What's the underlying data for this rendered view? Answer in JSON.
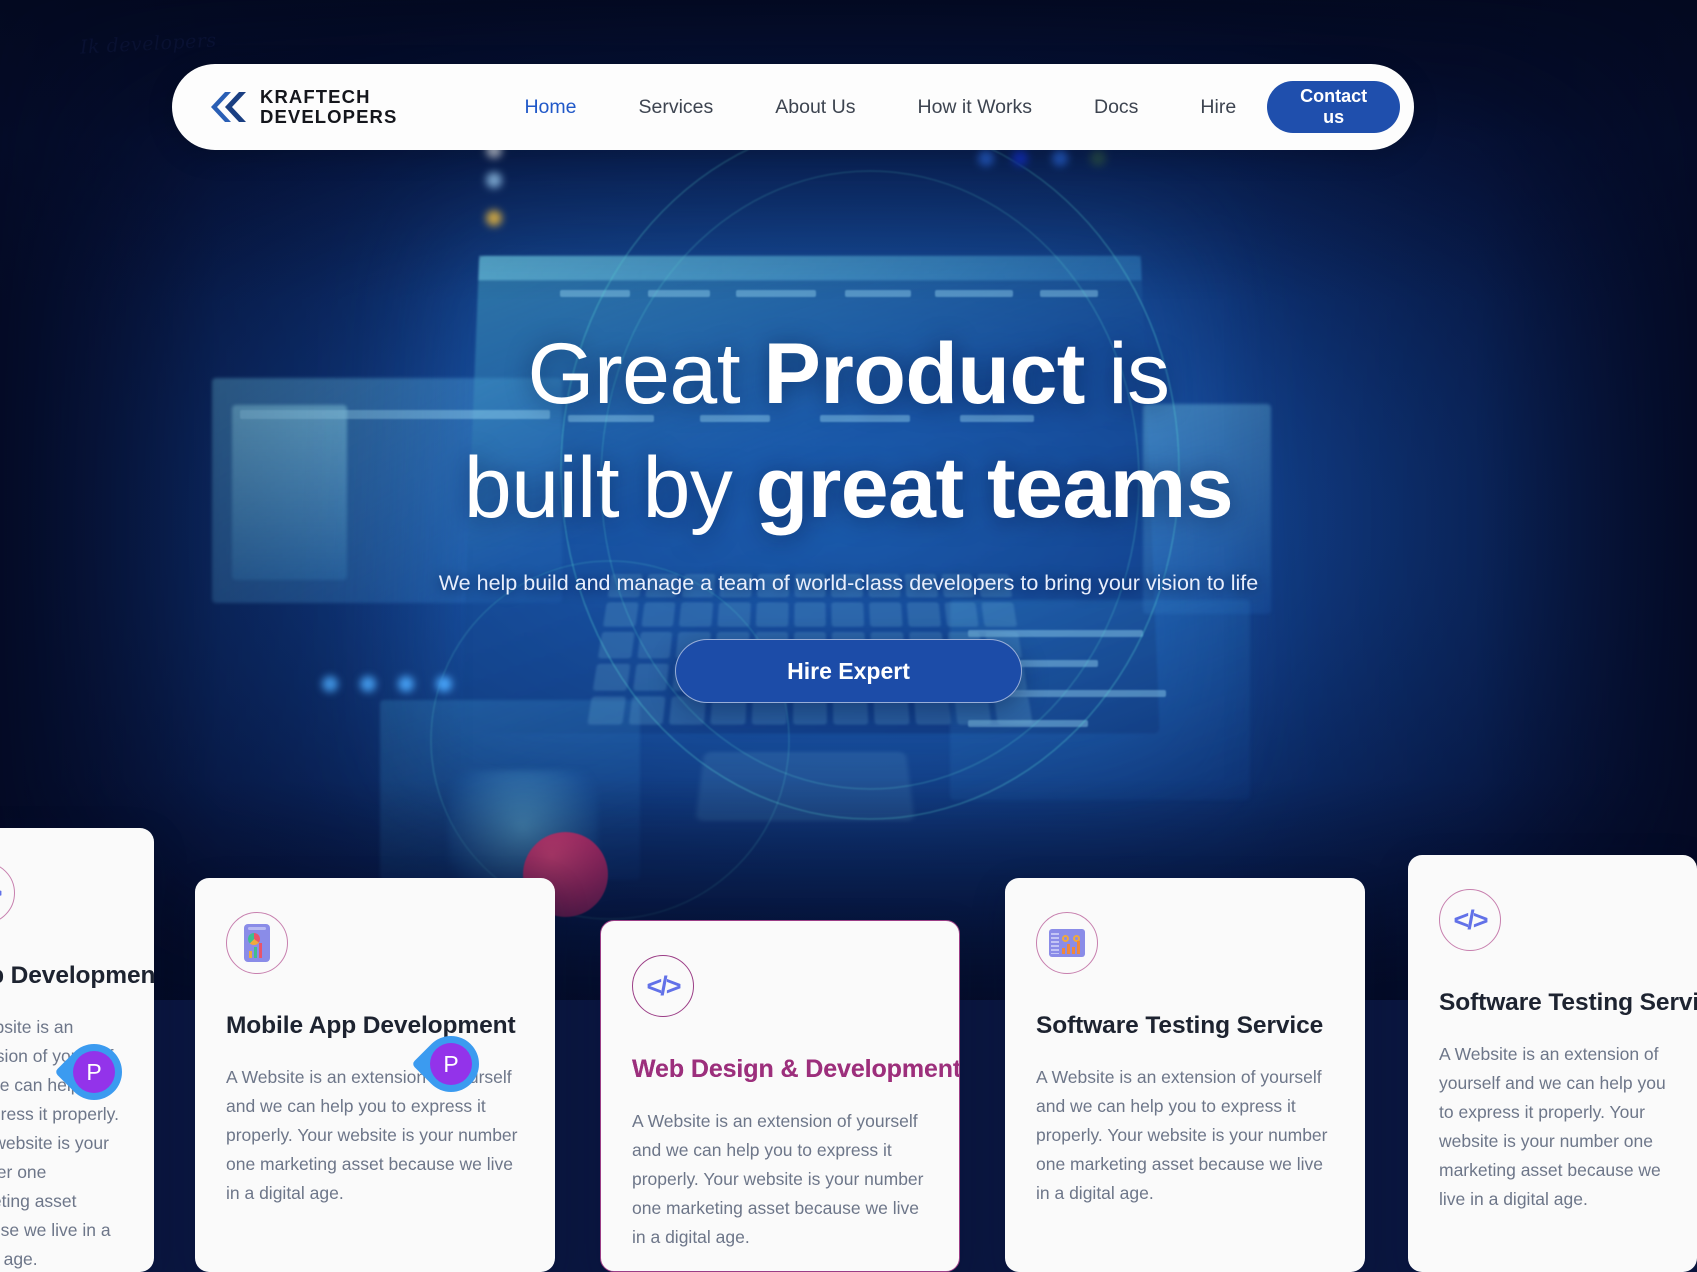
{
  "watermark": {
    "text": "Ik developers"
  },
  "navbar": {
    "brand": {
      "line1": "KRAFTECH",
      "line2": "DEVELOPERS",
      "logo_icon": "double-chevron-logo-icon"
    },
    "links": [
      {
        "label": "Home",
        "active": true
      },
      {
        "label": "Services",
        "active": false
      },
      {
        "label": "About Us",
        "active": false
      },
      {
        "label": "How it Works",
        "active": false
      },
      {
        "label": "Docs",
        "active": false
      },
      {
        "label": "Hire",
        "active": false
      }
    ],
    "cta": {
      "label": "Contact us",
      "bg": "#1f4fad",
      "color": "#ffffff"
    }
  },
  "hero": {
    "title_part1": "Great ",
    "title_strong1": "Product",
    "title_part2": " is",
    "title_part3": "built by ",
    "title_strong2": "great teams",
    "subtitle": "We help build and manage a team of world-class developers to bring your vision to life",
    "cta": {
      "label": "Hire Expert",
      "bg": "#1c4ca8",
      "color": "#ffffff"
    }
  },
  "cards": [
    {
      "id": "left-partial",
      "title": "Web Development",
      "body": "A Website is an extension of yourself and we can help you to express it properly. Your website is your number one marketing asset because we live in a digital age.",
      "icon": "code-icon",
      "accent": "#c77fae",
      "highlighted": false
    },
    {
      "id": "mobile-app",
      "title": "Mobile App Development",
      "body": "A Website is an extension of yourself and we can help you to express it properly. Your website is your number one marketing asset because we live in a digital age.",
      "icon": "phone-chart-icon",
      "accent": "#c77fae",
      "highlighted": false
    },
    {
      "id": "web-design",
      "title": "Web Design & Development",
      "body": "A Website is an extension of yourself and we can help you to express it properly. Your website is your number one marketing asset because we live in a digital age.",
      "icon": "code-icon",
      "accent": "#9b3d86",
      "highlighted": true
    },
    {
      "id": "software-testing",
      "title": "Software Testing Service",
      "body": "A Website is an extension of yourself and we can help you to express it properly. Your website is your number one marketing asset because we live in a digital age.",
      "icon": "window-chart-icon",
      "accent": "#c77fae",
      "highlighted": false
    },
    {
      "id": "right-partial",
      "title": "Software Testing Service",
      "body": "A Website is an extension of yourself and we can help you to express it properly. Your website is your number one marketing asset because we live in a digital age.",
      "icon": "code-icon",
      "accent": "#c77fae",
      "highlighted": false
    }
  ],
  "cursors": [
    {
      "label": "P",
      "pin_color": "#3b9bf0",
      "dot_color": "#9333ea"
    },
    {
      "label": "P",
      "pin_color": "#3b9bf0",
      "dot_color": "#9333ea"
    }
  ]
}
